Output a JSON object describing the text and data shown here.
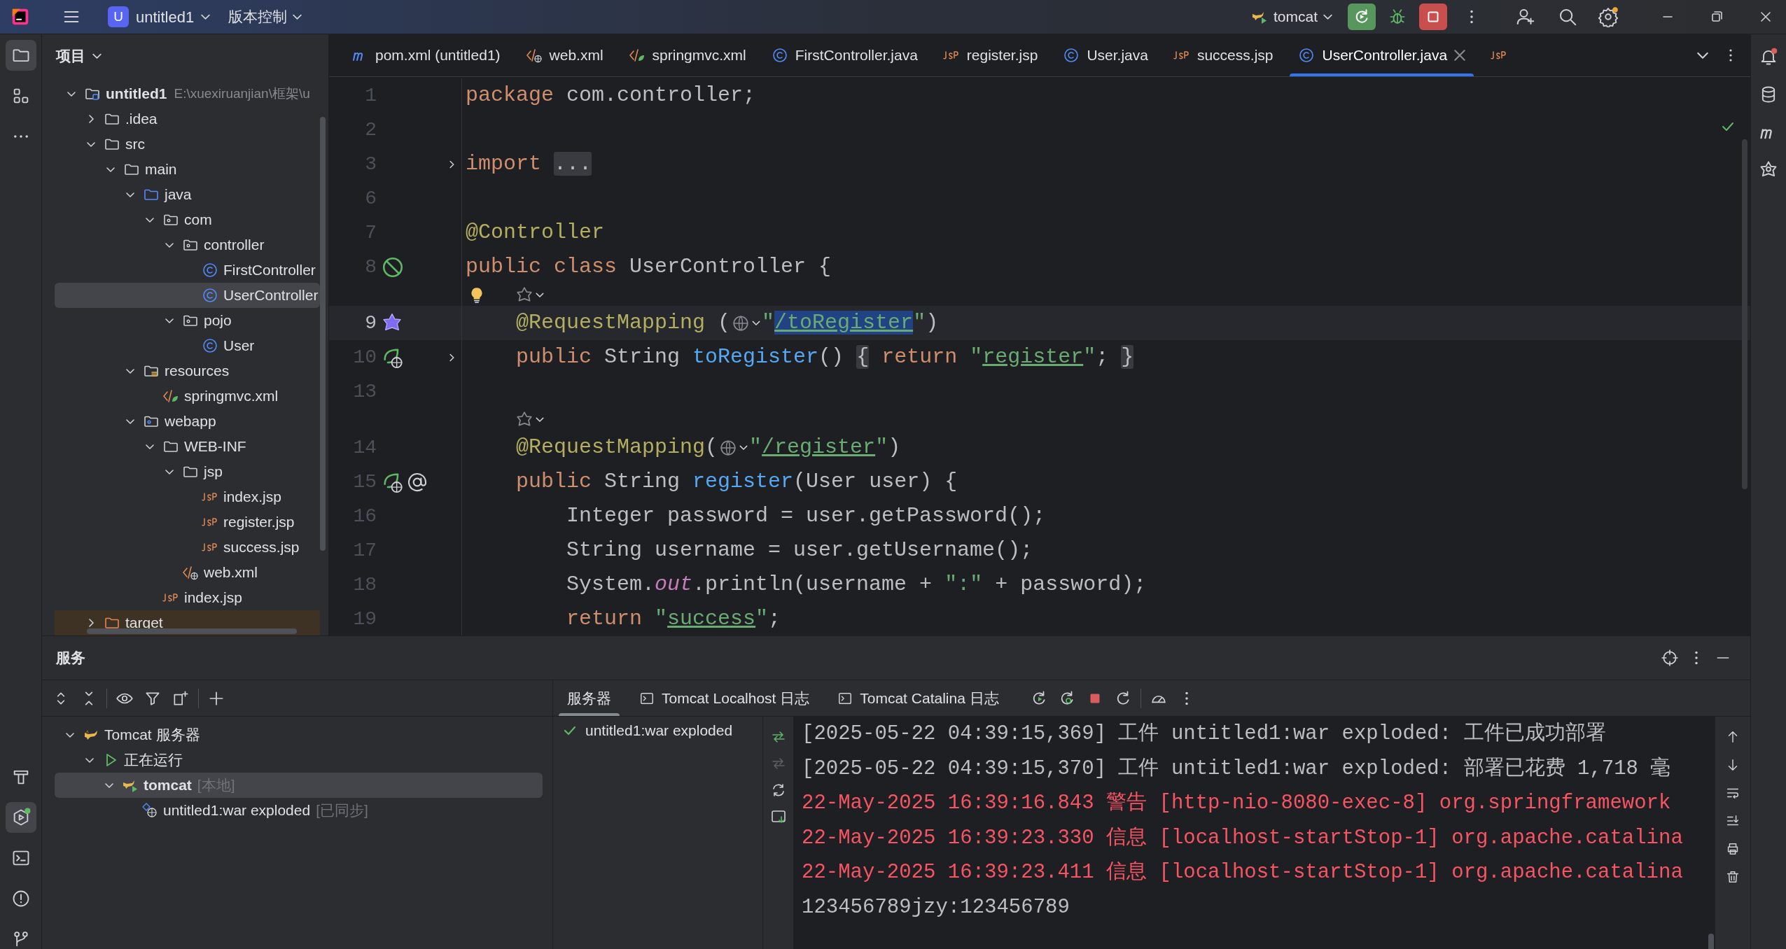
{
  "title_bar": {
    "project_badge": "U",
    "project": "untitled1",
    "vcs": "版本控制",
    "run_config": "tomcat"
  },
  "project_panel": {
    "title": "项目",
    "tree": [
      {
        "label": "untitled1",
        "path": "E:\\xuexiruanjian\\框架\\u",
        "kind": "module",
        "expanded": true,
        "selected": false,
        "children": [
          {
            "label": ".idea",
            "kind": "folder",
            "expanded": false,
            "selected": false
          },
          {
            "label": "src",
            "kind": "folder",
            "expanded": true,
            "selected": false,
            "children": [
              {
                "label": "main",
                "kind": "folder",
                "expanded": true,
                "selected": false,
                "children": [
                  {
                    "label": "java",
                    "kind": "source",
                    "expanded": true,
                    "selected": false,
                    "children": [
                      {
                        "label": "com",
                        "kind": "package",
                        "expanded": true,
                        "selected": false,
                        "children": [
                          {
                            "label": "controller",
                            "kind": "package",
                            "expanded": true,
                            "selected": false,
                            "children": [
                              {
                                "label": "FirstController",
                                "kind": "class",
                                "selected": false
                              },
                              {
                                "label": "UserController",
                                "kind": "class",
                                "selected": true
                              }
                            ]
                          },
                          {
                            "label": "pojo",
                            "kind": "package",
                            "expanded": true,
                            "selected": false,
                            "children": [
                              {
                                "label": "User",
                                "kind": "class",
                                "selected": false
                              }
                            ]
                          }
                        ]
                      }
                    ]
                  },
                  {
                    "label": "resources",
                    "kind": "resources",
                    "expanded": true,
                    "selected": false,
                    "children": [
                      {
                        "label": "springmvc.xml",
                        "kind": "xml-spring",
                        "selected": false
                      }
                    ]
                  },
                  {
                    "label": "webapp",
                    "kind": "webapp",
                    "expanded": true,
                    "selected": false,
                    "children": [
                      {
                        "label": "WEB-INF",
                        "kind": "folder",
                        "expanded": true,
                        "selected": false,
                        "children": [
                          {
                            "label": "jsp",
                            "kind": "folder",
                            "expanded": true,
                            "selected": false,
                            "children": [
                              {
                                "label": "index.jsp",
                                "kind": "jsp",
                                "selected": false
                              },
                              {
                                "label": "register.jsp",
                                "kind": "jsp",
                                "selected": false
                              },
                              {
                                "label": "success.jsp",
                                "kind": "jsp",
                                "selected": false
                              }
                            ]
                          },
                          {
                            "label": "web.xml",
                            "kind": "xml-web",
                            "selected": false
                          }
                        ]
                      },
                      {
                        "label": "index.jsp",
                        "kind": "jsp",
                        "selected": false
                      }
                    ]
                  }
                ]
              }
            ]
          },
          {
            "label": "target",
            "kind": "excluded",
            "expanded": false,
            "selected": false
          }
        ]
      }
    ]
  },
  "editor": {
    "tabs": [
      {
        "label": "pom.xml (untitled1)",
        "kind": "maven",
        "selected": false
      },
      {
        "label": "web.xml",
        "kind": "xml-web",
        "selected": false
      },
      {
        "label": "springmvc.xml",
        "kind": "xml-spring",
        "selected": false
      },
      {
        "label": "FirstController.java",
        "kind": "class",
        "selected": false
      },
      {
        "label": "register.jsp",
        "kind": "jsp",
        "selected": false
      },
      {
        "label": "User.java",
        "kind": "class",
        "selected": false
      },
      {
        "label": "success.jsp",
        "kind": "jsp",
        "selected": false
      },
      {
        "label": "UserController.java",
        "kind": "class",
        "selected": true
      },
      {
        "kind": "jsp",
        "selected": false
      }
    ],
    "lines": [
      {
        "kind": "code",
        "number": "1",
        "tokens": [
          {
            "kind": "keyword",
            "text": "package"
          },
          {
            "kind": "plain",
            "text": " com.controller;"
          }
        ]
      },
      {
        "kind": "code",
        "number": "2"
      },
      {
        "kind": "code",
        "number": "3",
        "folded": true,
        "tokens": [
          {
            "kind": "keyword",
            "text": "import "
          },
          {
            "kind": "fold",
            "text": "..."
          }
        ]
      },
      {
        "kind": "code",
        "number": "6"
      },
      {
        "kind": "code",
        "number": "7",
        "tokens": [
          {
            "kind": "annotation",
            "text": "@Controller"
          }
        ]
      },
      {
        "kind": "code",
        "number": "8",
        "gutter": {
          "kind": "bean"
        },
        "tokens": [
          {
            "kind": "keyword",
            "text": "public class "
          },
          {
            "kind": "plain",
            "text": "UserController {"
          }
        ]
      },
      {
        "kind": "inlay",
        "bulb": true
      },
      {
        "kind": "code",
        "number": "9",
        "current": true,
        "gutter": {
          "kind": "spring"
        },
        "tokens": [
          {
            "kind": "annotation",
            "text": "    @RequestMapping"
          },
          {
            "kind": "plain",
            "text": " ("
          },
          {
            "kind": "globe"
          },
          {
            "kind": "string",
            "text": "\""
          },
          {
            "kind": "selected",
            "text": "/toRegister"
          },
          {
            "kind": "string",
            "text": "\""
          },
          {
            "kind": "plain",
            "text": ")"
          }
        ]
      },
      {
        "kind": "code",
        "number": "10",
        "gutter": {
          "kind": "web"
        },
        "folded": true,
        "tokens": [
          {
            "kind": "keyword",
            "text": "    public "
          },
          {
            "kind": "plain",
            "text": "String "
          },
          {
            "kind": "function",
            "text": "toRegister"
          },
          {
            "kind": "plain",
            "text": "() "
          },
          {
            "kind": "fold",
            "text": "{"
          },
          {
            "kind": "keyword",
            "text": " return "
          },
          {
            "kind": "string",
            "text": "\""
          },
          {
            "kind": "link",
            "text": "register"
          },
          {
            "kind": "string",
            "text": "\""
          },
          {
            "kind": "plain",
            "text": "; "
          },
          {
            "kind": "fold",
            "text": "}"
          }
        ]
      },
      {
        "kind": "code",
        "number": "13"
      },
      {
        "kind": "inlay",
        "bulb": false
      },
      {
        "kind": "code",
        "number": "14",
        "tokens": [
          {
            "kind": "annotation",
            "text": "    @RequestMapping"
          },
          {
            "kind": "plain",
            "text": "("
          },
          {
            "kind": "globe"
          },
          {
            "kind": "string",
            "text": "\""
          },
          {
            "kind": "link",
            "text": "/register"
          },
          {
            "kind": "string",
            "text": "\""
          },
          {
            "kind": "plain",
            "text": ")"
          }
        ]
      },
      {
        "kind": "code",
        "number": "15",
        "gutter": {
          "kind": "web-at"
        },
        "tokens": [
          {
            "kind": "keyword",
            "text": "    public "
          },
          {
            "kind": "plain",
            "text": "String "
          },
          {
            "kind": "function",
            "text": "register"
          },
          {
            "kind": "plain",
            "text": "(User user) {"
          }
        ]
      },
      {
        "kind": "code",
        "number": "16",
        "tokens": [
          {
            "kind": "plain",
            "text": "        Integer password = user.getPassword();"
          }
        ]
      },
      {
        "kind": "code",
        "number": "17",
        "tokens": [
          {
            "kind": "plain",
            "text": "        String username = user.getUsername();"
          }
        ]
      },
      {
        "kind": "code",
        "number": "18",
        "tokens": [
          {
            "kind": "plain",
            "text": "        System."
          },
          {
            "kind": "static",
            "text": "out"
          },
          {
            "kind": "plain",
            "text": ".println(username + "
          },
          {
            "kind": "string",
            "text": "\":\""
          },
          {
            "kind": "plain",
            "text": " + password);"
          }
        ]
      },
      {
        "kind": "code",
        "number": "19",
        "tokens": [
          {
            "kind": "keyword",
            "text": "        return "
          },
          {
            "kind": "string",
            "text": "\""
          },
          {
            "kind": "link",
            "text": "success"
          },
          {
            "kind": "string",
            "text": "\""
          },
          {
            "kind": "plain",
            "text": ";"
          }
        ]
      }
    ]
  },
  "services": {
    "title": "服务",
    "tree": [
      {
        "label": "Tomcat 服务器",
        "kind": "tomcat",
        "expanded": true,
        "selected": false,
        "children": [
          {
            "label": "正在运行",
            "kind": "running",
            "expanded": true,
            "selected": false,
            "children": [
              {
                "label": "tomcat",
                "note": "[本地]",
                "kind": "tomcat-run",
                "expanded": true,
                "selected": true,
                "children": [
                  {
                    "label": "untitled1:war exploded",
                    "note": "[已同步]",
                    "kind": "artifact",
                    "selected": false
                  }
                ]
              }
            ]
          }
        ]
      }
    ],
    "tabs": [
      {
        "label": "服务器",
        "terminal_icon": false,
        "selected": true
      },
      {
        "label": "Tomcat Localhost 日志",
        "terminal_icon": true,
        "selected": false
      },
      {
        "label": "Tomcat Catalina 日志",
        "terminal_icon": true,
        "selected": false
      }
    ],
    "deployments": [
      {
        "label": "untitled1:war exploded"
      }
    ],
    "console": [
      {
        "kind": "info",
        "text": "[2025-05-22 04:39:15,369] 工件 untitled1:war exploded: 工件已成功部署"
      },
      {
        "kind": "info",
        "text": "[2025-05-22 04:39:15,370] 工件 untitled1:war exploded: 部署已花费 1,718 毫"
      },
      {
        "kind": "error",
        "text": "22-May-2025 16:39:16.843 警告 [http-nio-8080-exec-8] org.springframework"
      },
      {
        "kind": "error",
        "text": "22-May-2025 16:39:23.330 信息 [localhost-startStop-1] org.apache.catalina"
      },
      {
        "kind": "error",
        "text": "22-May-2025 16:39:23.411 信息 [localhost-startStop-1] org.apache.catalina"
      },
      {
        "kind": "info",
        "text": "123456789jzy:123456789"
      }
    ]
  }
}
